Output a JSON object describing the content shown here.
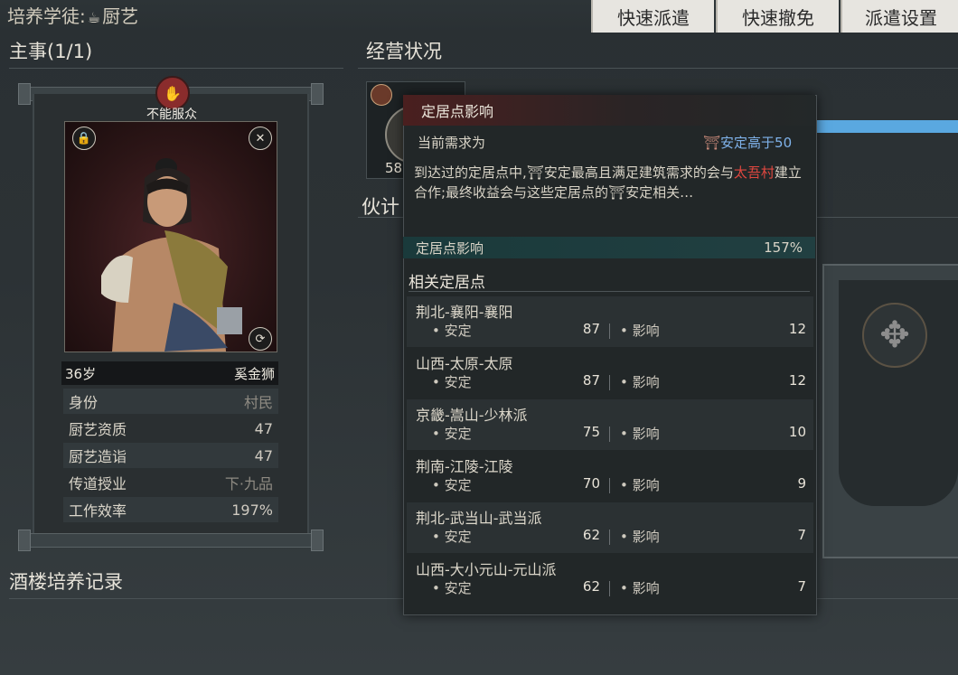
{
  "header": {
    "apprentice_label": "培养学徒:",
    "apprentice_skill": "厨艺",
    "buttons": [
      "快速派遣",
      "快速撤免",
      "派遣设置"
    ]
  },
  "left": {
    "section_title": "主事(1/1)",
    "badge_text": "不能服众",
    "character": {
      "age": "36岁",
      "name": "奚金狮",
      "stats": [
        {
          "key": "身份",
          "value": "村民"
        },
        {
          "key": "厨艺资质",
          "value": "47"
        },
        {
          "key": "厨艺造诣",
          "value": "47"
        },
        {
          "key": "传道授业",
          "value": "下·九品"
        },
        {
          "key": "工作效率",
          "value": "197%"
        }
      ]
    },
    "records_title": "酒楼培养记录"
  },
  "right": {
    "section_title": "经营状况",
    "card_number": "58",
    "partner_title": "伙计"
  },
  "tooltip": {
    "title": "定居点影响",
    "req_label": "当前需求为",
    "req_value": "安定高于50",
    "desc_part1": "到达过的定居点中,",
    "desc_part2": "安定最高且满足建筑需求的会与",
    "desc_highlight": "太吾村",
    "desc_part3": "建立合作;最终收益会与这些定居点的",
    "desc_part4": "安定相关…",
    "influence_label": "定居点影响",
    "influence_value": "157%",
    "related_title": "相关定居点",
    "stability_label": "安定",
    "influence_short": "影响",
    "settlements": [
      {
        "name": "荆北-襄阳-襄阳",
        "stability": "87",
        "influence": "12"
      },
      {
        "name": "山西-太原-太原",
        "stability": "87",
        "influence": "12"
      },
      {
        "name": "京畿-嵩山-少林派",
        "stability": "75",
        "influence": "10"
      },
      {
        "name": "荆南-江陵-江陵",
        "stability": "70",
        "influence": "9"
      },
      {
        "name": "荆北-武当山-武当派",
        "stability": "62",
        "influence": "7"
      },
      {
        "name": "山西-大小元山-元山派",
        "stability": "62",
        "influence": "7"
      }
    ]
  },
  "colors": {
    "accent_red": "#e0473f",
    "accent_blue": "#7fb2ea",
    "progress_blue": "#5aa8e0"
  }
}
